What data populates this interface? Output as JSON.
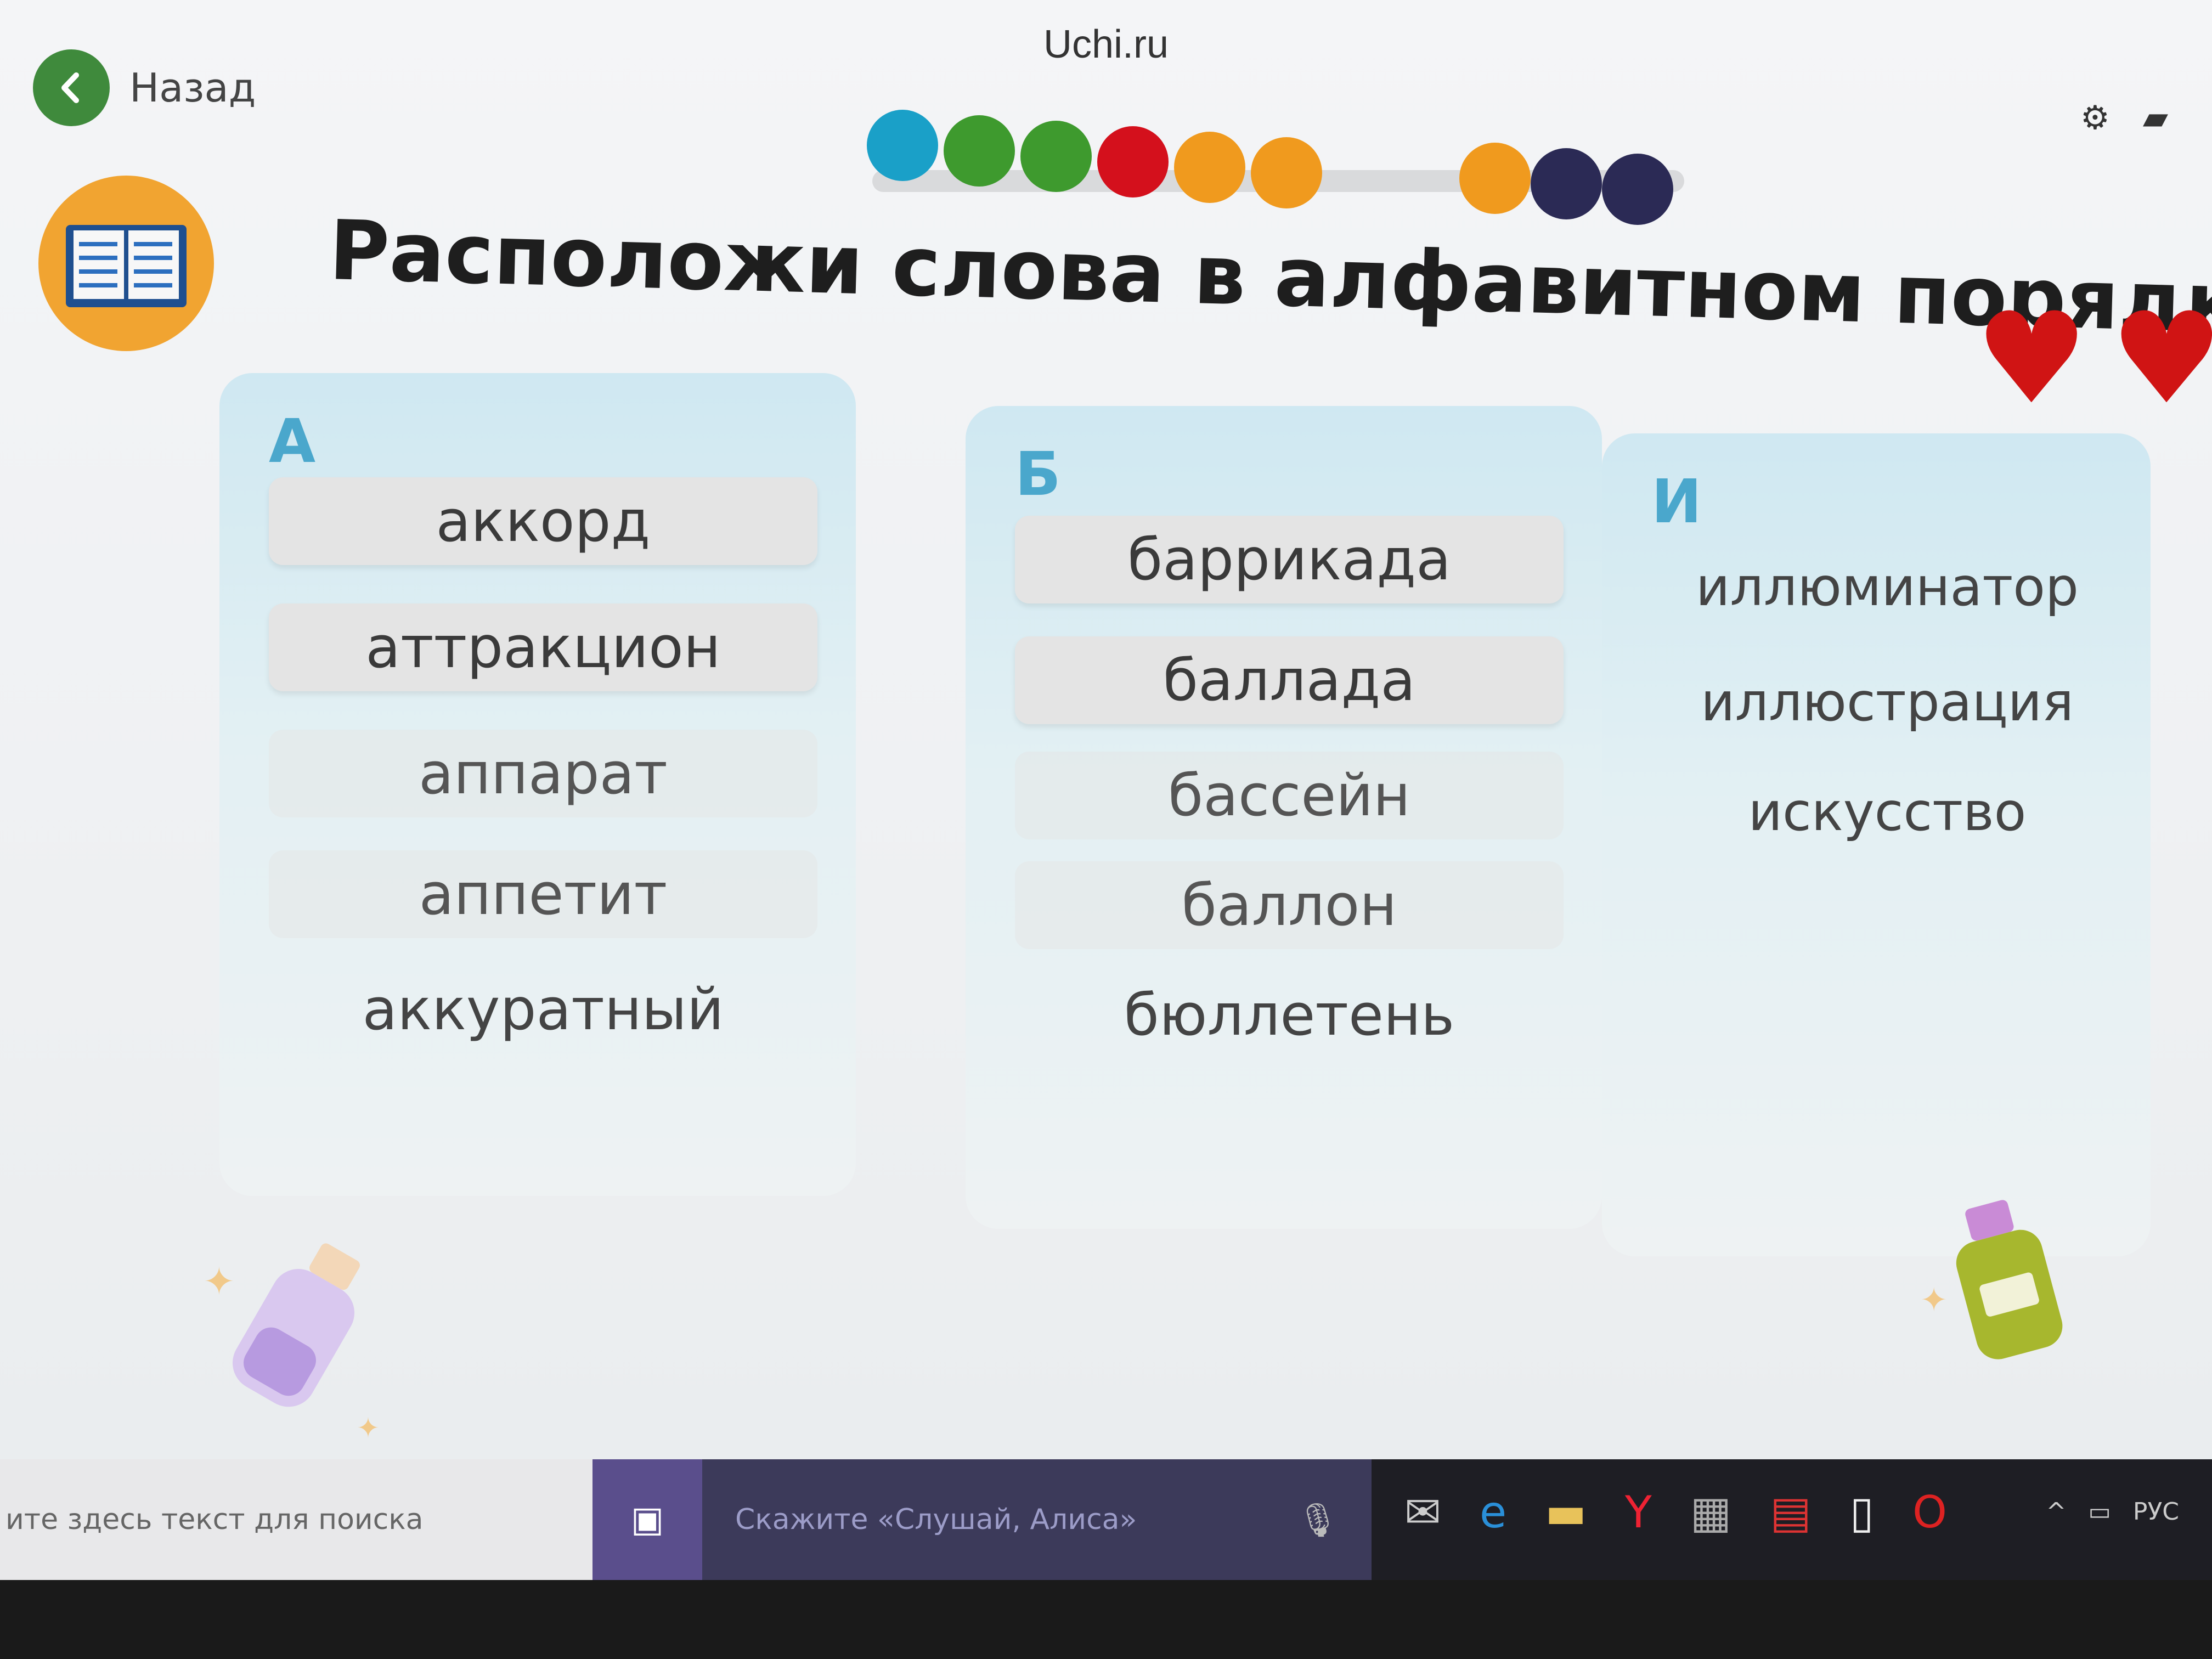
{
  "header": {
    "site_title": "Uchi.ru",
    "back_label": "Назад"
  },
  "progress": {
    "dot_colors": [
      "#1aa0c8",
      "#3e9a2e",
      "#3e9a2e",
      "#d4101c",
      "#f09a1e",
      "#f09a1e",
      "#f09a1e",
      "#2b2a55",
      "#2b2a55"
    ]
  },
  "task": {
    "title": "Расположи слова в алфавитном порядке",
    "hearts_count": 2
  },
  "columns": [
    {
      "letter": "А",
      "words": [
        "аккорд",
        "аттракцион",
        "аппарат",
        "аппетит",
        "аккуратный"
      ]
    },
    {
      "letter": "Б",
      "words": [
        "баррикада",
        "баллада",
        "бассейн",
        "баллон",
        "бюллетень"
      ]
    },
    {
      "letter": "И",
      "words": [
        "иллюминатор",
        "иллюстрация",
        "искусство"
      ]
    }
  ],
  "taskbar": {
    "search_placeholder": "ите здесь текст для поиска",
    "alisa_placeholder": "Скажите «Слушай, Алиса»",
    "language": "РУС"
  },
  "colors": {
    "accent_green": "#3f8a3c",
    "lesson_icon_bg": "#f1a431",
    "heart": "#d01414",
    "letter_blue": "#4aa7cc"
  }
}
